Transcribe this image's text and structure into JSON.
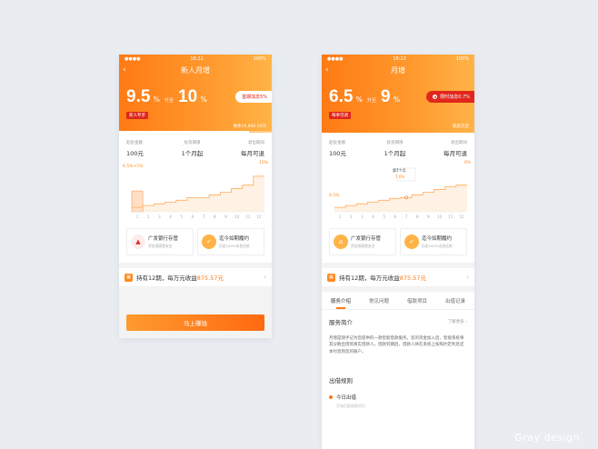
{
  "watermark": "Gray design",
  "phone1": {
    "status": {
      "time": "18:22",
      "battery": "100%"
    },
    "title": "新人月增",
    "rate_min": "9.5",
    "rate_max": "10",
    "pct": "%",
    "rate_sep": "升至",
    "tag": "新人专享",
    "promo": "首期加息5%",
    "remaining": "剩余19,800.00元",
    "remaining_fraction": 0.85,
    "terms": [
      {
        "label": "起投金额",
        "value": "100元"
      },
      {
        "label": "投资期限",
        "value": "1个月起"
      },
      {
        "label": "退出期间",
        "value": "每月可退"
      }
    ],
    "chart_start_label": "6.5%+5%",
    "chart_end_label": "10%",
    "features": [
      {
        "title": "广发银行存管",
        "sub": "资金隔离更安全"
      },
      {
        "title": "迄今如期履约",
        "sub": "历史100%本息还款"
      }
    ],
    "earn_prefix": "持有12期，每万元收益",
    "earn_amount": "875.57元",
    "cta": "马上赚钱"
  },
  "phone2": {
    "status": {
      "time": "18:22",
      "battery": "100%"
    },
    "title": "月增",
    "rate_min": "6.5",
    "rate_max": "9",
    "pct": "%",
    "rate_sep": "升至",
    "tag": "每季可调",
    "promo": "限时加息0.7%",
    "remaining": "额度充足",
    "terms": [
      {
        "label": "起投金额",
        "value": "100元"
      },
      {
        "label": "投资期限",
        "value": "1个月起"
      },
      {
        "label": "退出期间",
        "value": "每月可退"
      }
    ],
    "chart_start_label": "6.5%",
    "chart_end_label": "9%",
    "chart_tooltip_title": "第7个月",
    "chart_tooltip_value": "7.6%",
    "features": [
      {
        "title": "广发银行存管",
        "sub": "资金隔离更安全"
      },
      {
        "title": "迄今如期履约",
        "sub": "历史100%本息还款"
      }
    ],
    "earn_prefix": "持有12期，每万元收益",
    "earn_amount": "875.57元",
    "tabs": [
      "服务介绍",
      "常见问题",
      "借款项目",
      "出借记录"
    ],
    "service_title": "服务简介",
    "service_more": "了解更多",
    "service_body": "月增是随手记为您提供的一款智能借款服务。您的资金加入后，智能系统将其分散出借到真实借款人。借款到期后，借款人将在系统上按照约定利息还本付息到您的账户。",
    "rules_title": "出借规则",
    "rule_item": "今日出借",
    "rule_sub": "开始匹配借款项目"
  },
  "chart_data": [
    {
      "type": "line",
      "x": [
        1,
        2,
        3,
        4,
        5,
        6,
        7,
        8,
        9,
        10,
        11,
        12
      ],
      "values": [
        6.5,
        6.7,
        6.9,
        7.1,
        7.3,
        7.6,
        7.6,
        7.9,
        8.2,
        8.6,
        9.0,
        10.0
      ],
      "ylim": [
        6,
        10.5
      ]
    },
    {
      "type": "line",
      "x": [
        1,
        2,
        3,
        4,
        5,
        6,
        7,
        8,
        9,
        10,
        11,
        12
      ],
      "values": [
        6.5,
        6.7,
        6.9,
        7.1,
        7.3,
        7.5,
        7.6,
        7.9,
        8.2,
        8.5,
        8.8,
        9.0
      ],
      "ylim": [
        6,
        10.5
      ]
    }
  ]
}
